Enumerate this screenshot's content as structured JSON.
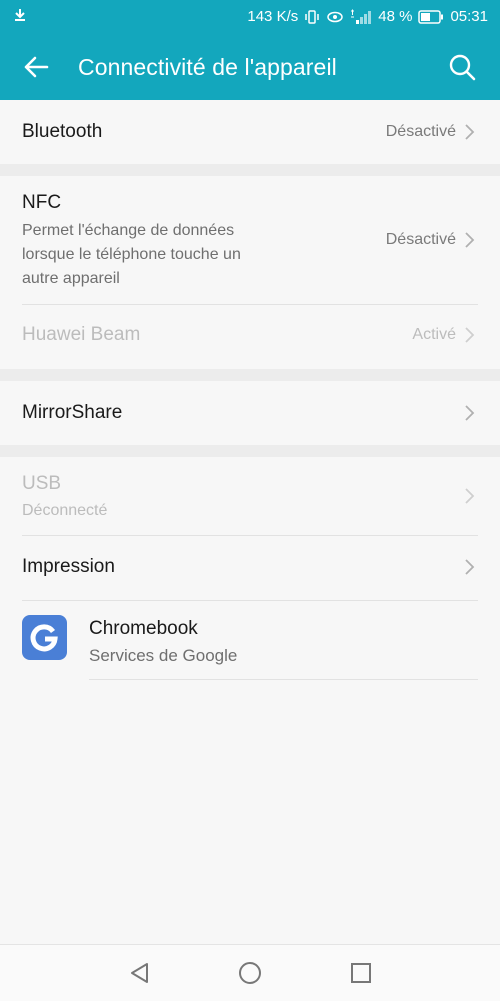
{
  "status_bar": {
    "speed": "143 K/s",
    "battery": "48 %",
    "time": "05:31"
  },
  "app_bar": {
    "title": "Connectivité de l'appareil"
  },
  "items": {
    "bluetooth": {
      "label": "Bluetooth",
      "value": "Désactivé"
    },
    "nfc": {
      "label": "NFC",
      "description_lines": [
        "Permet l'échange de données",
        "lorsque le téléphone touche un",
        "autre appareil"
      ],
      "value": "Désactivé"
    },
    "huawei_beam": {
      "label": "Huawei Beam",
      "value": "Activé"
    },
    "mirrorshare": {
      "label": "MirrorShare"
    },
    "usb": {
      "label": "USB",
      "sublabel": "Déconnecté"
    },
    "impression": {
      "label": "Impression"
    },
    "chromebook": {
      "label": "Chromebook",
      "sublabel": "Services de Google",
      "icon": "google-g-icon"
    }
  },
  "colors": {
    "accent": "#13a7bd",
    "google_icon_bg": "#4a7fd6"
  }
}
